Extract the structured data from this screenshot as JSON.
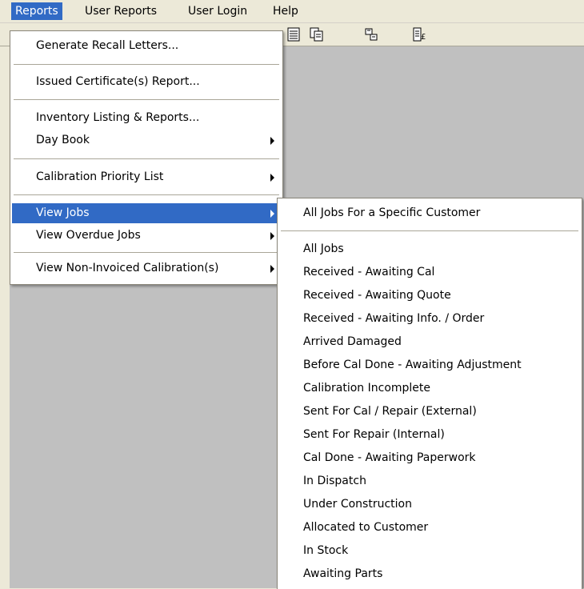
{
  "menubar": {
    "items": [
      "Reports",
      "User Reports",
      "User Login",
      "Help"
    ]
  },
  "toolbar": {
    "icons": [
      "document-list-icon",
      "document-copy-icon",
      "network-icon",
      "document-currency-icon"
    ]
  },
  "reports_menu": {
    "items": [
      "Generate Recall Letters...",
      "Issued Certificate(s) Report...",
      "Inventory Listing & Reports...",
      "Day Book",
      "Calibration Priority List",
      "View Jobs",
      "View Overdue Jobs",
      "View Non-Invoiced Calibration(s)"
    ]
  },
  "view_jobs_submenu": {
    "items": [
      "All Jobs For a Specific Customer",
      "All Jobs",
      "Received - Awaiting Cal",
      "Received - Awaiting Quote",
      "Received - Awaiting Info. / Order",
      "Arrived Damaged",
      "Before Cal Done - Awaiting Adjustment",
      "Calibration Incomplete",
      "Sent For Cal / Repair (External)",
      "Sent For Repair (Internal)",
      "Cal Done - Awaiting Paperwork",
      "In Dispatch",
      "Under Construction",
      "Allocated to Customer",
      "In Stock",
      "Awaiting Parts"
    ]
  },
  "colors": {
    "highlight": "#316ac5",
    "workspace": "#c0c0c0",
    "chrome": "#ece9d8"
  }
}
